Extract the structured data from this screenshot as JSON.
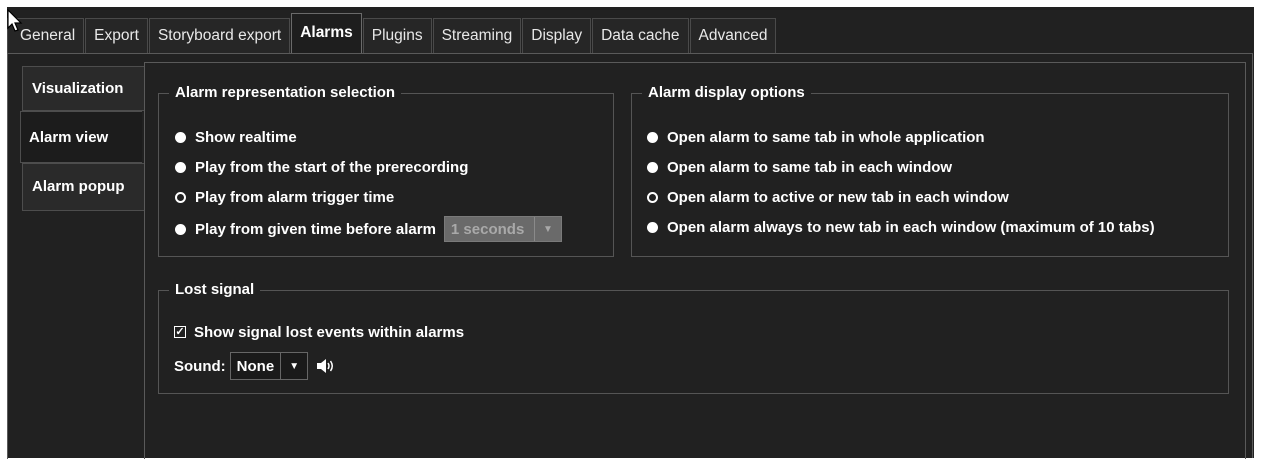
{
  "top_tabs": [
    {
      "label": "General"
    },
    {
      "label": "Export"
    },
    {
      "label": "Storyboard export"
    },
    {
      "label": "Alarms"
    },
    {
      "label": "Plugins"
    },
    {
      "label": "Streaming"
    },
    {
      "label": "Display"
    },
    {
      "label": "Data cache"
    },
    {
      "label": "Advanced"
    }
  ],
  "active_top_tab": "Alarms",
  "side_tabs": [
    {
      "label": "Visualization"
    },
    {
      "label": "Alarm view"
    },
    {
      "label": "Alarm popup"
    }
  ],
  "active_side_tab": "Alarm view",
  "representation": {
    "title": "Alarm representation selection",
    "options": [
      {
        "label": "Show realtime",
        "selected": false
      },
      {
        "label": "Play from the start of the prerecording",
        "selected": false
      },
      {
        "label": "Play from alarm trigger time",
        "selected": true
      },
      {
        "label": "Play from given time before alarm",
        "selected": false
      }
    ],
    "time_combo_value": "1 seconds"
  },
  "display_options": {
    "title": "Alarm display options",
    "options": [
      {
        "label": "Open alarm to same tab in whole application",
        "selected": false
      },
      {
        "label": "Open alarm to same tab in each window",
        "selected": false
      },
      {
        "label": "Open alarm to active or new tab in each window",
        "selected": true
      },
      {
        "label": "Open alarm always to new tab in each window (maximum of 10 tabs)",
        "selected": false
      }
    ]
  },
  "lost_signal": {
    "title": "Lost signal",
    "checkbox_label": "Show signal lost events within alarms",
    "checked": true,
    "sound_label": "Sound:",
    "sound_value": "None"
  },
  "icons": {
    "cursor": "pointer-cursor-icon",
    "speaker": "speaker-icon",
    "dropdown": "chevron-down-icon"
  },
  "colors": {
    "background": "#212121",
    "border": "#555555",
    "text": "#ffffff"
  }
}
